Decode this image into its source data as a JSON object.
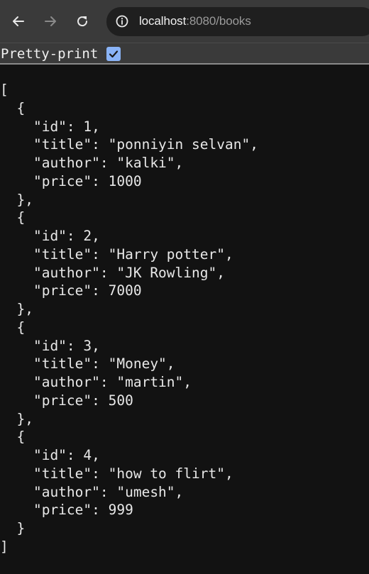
{
  "browser": {
    "url_host": "localhost",
    "url_rest": ":8080/books",
    "icons": {
      "back": "arrow-left-icon",
      "forward": "arrow-right-icon",
      "reload": "reload-icon",
      "site_info": "site-info-icon"
    }
  },
  "viewer": {
    "pretty_print_label": "Pretty-print",
    "pretty_print_checked": true,
    "checkbox_color": "#8ab4f8"
  },
  "json_lines": [
    "[",
    "  {",
    "    \"id\": 1,",
    "    \"title\": \"ponniyin selvan\",",
    "    \"author\": \"kalki\",",
    "    \"price\": 1000",
    "  },",
    "  {",
    "    \"id\": 2,",
    "    \"title\": \"Harry potter\",",
    "    \"author\": \"JK Rowling\",",
    "    \"price\": 7000",
    "  },",
    "  {",
    "    \"id\": 3,",
    "    \"title\": \"Money\",",
    "    \"author\": \"martin\",",
    "    \"price\": 500",
    "  },",
    "  {",
    "    \"id\": 4,",
    "    \"title\": \"how to flirt\",",
    "    \"author\": \"umesh\",",
    "    \"price\": 999",
    "  }",
    "]"
  ]
}
